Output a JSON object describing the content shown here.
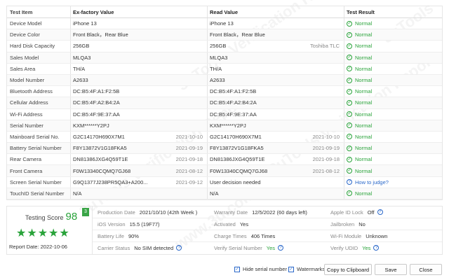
{
  "watermarks": [
    "3uTools Verification Report",
    "3uTools Verification Report",
    "3uTools Verification Report",
    "3uTools",
    "www.3u.com"
  ],
  "table": {
    "headers": [
      "Test Item",
      "Ex-factory Value",
      "Read Value",
      "Test Result"
    ],
    "rows": [
      {
        "item": "Device Model",
        "ex": "iPhone 13",
        "ex_date": "",
        "read": "iPhone 13",
        "read_extra": "",
        "result": "Normal",
        "status": "ok"
      },
      {
        "item": "Device Color",
        "ex": "Front Black，Rear Blue",
        "ex_date": "",
        "read": "Front Black，Rear Blue",
        "read_extra": "",
        "result": "Normal",
        "status": "ok"
      },
      {
        "item": "Hard Disk Capacity",
        "ex": "256GB",
        "ex_date": "",
        "read": "256GB",
        "read_extra": "Toshiba TLC",
        "result": "Normal",
        "status": "ok"
      },
      {
        "item": "Sales Model",
        "ex": "MLQA3",
        "ex_date": "",
        "read": "MLQA3",
        "read_extra": "",
        "result": "Normal",
        "status": "ok"
      },
      {
        "item": "Sales Area",
        "ex": "TH/A",
        "ex_date": "",
        "read": "TH/A",
        "read_extra": "",
        "result": "Normal",
        "status": "ok"
      },
      {
        "item": "Model Number",
        "ex": "A2633",
        "ex_date": "",
        "read": "A2633",
        "read_extra": "",
        "result": "Normal",
        "status": "ok"
      },
      {
        "item": "Bluetooth Address",
        "ex": "DC:B5:4F:A1:F2:5B",
        "ex_date": "",
        "read": "DC:B5:4F:A1:F2:5B",
        "read_extra": "",
        "result": "Normal",
        "status": "ok"
      },
      {
        "item": "Cellular Address",
        "ex": "DC:B5:4F:A2:B4:2A",
        "ex_date": "",
        "read": "DC:B5:4F:A2:B4:2A",
        "read_extra": "",
        "result": "Normal",
        "status": "ok"
      },
      {
        "item": "Wi-Fi Address",
        "ex": "DC:B5:4F:9E:37:AA",
        "ex_date": "",
        "read": "DC:B5:4F:9E:37:AA",
        "read_extra": "",
        "result": "Normal",
        "status": "ok"
      },
      {
        "item": "Serial Number",
        "ex": "KXM******Y2PJ",
        "ex_date": "",
        "read": "KXM******Y2PJ",
        "read_extra": "",
        "result": "Normal",
        "status": "ok"
      },
      {
        "item": "Mainboard Serial No.",
        "ex": "G2C14170H690X7M1",
        "ex_date": "2021-10-10",
        "read": "G2C14170H690X7M1",
        "read_extra": "2021-10-10",
        "result": "Normal",
        "status": "ok"
      },
      {
        "item": "Battery Serial Number",
        "ex": "F8Y13872V1G18FKA5",
        "ex_date": "2021-09-19",
        "read": "F8Y13872V1G18FKA5",
        "read_extra": "2021-09-19",
        "result": "Normal",
        "status": "ok"
      },
      {
        "item": "Rear Camera",
        "ex": "DN81386JXG4Q59T1E",
        "ex_date": "2021-09-18",
        "read": "DN81386JXG4Q59T1E",
        "read_extra": "2021-09-18",
        "result": "Normal",
        "status": "ok"
      },
      {
        "item": "Front Camera",
        "ex": "F0W13340CQMQ7GJ68",
        "ex_date": "2021-08-12",
        "read": "F0W13340CQMQ7GJ68",
        "read_extra": "2021-08-12",
        "result": "Normal",
        "status": "ok"
      },
      {
        "item": "Screen Serial Number",
        "ex": "G9Q1377J238PR5QA3+A200...",
        "ex_date": "2021-09-12",
        "read": "User decision needed",
        "read_extra": "",
        "result": "How to judge?",
        "status": "help"
      },
      {
        "item": "TouchID Serial Number",
        "ex": "N/A",
        "ex_date": "",
        "read": "N/A",
        "read_extra": "",
        "result": "Normal",
        "status": "ok"
      }
    ]
  },
  "score": {
    "label": "Testing Score",
    "value": "98",
    "badge": "3",
    "stars": "★★★★★",
    "report_date": "Report Date:  2022-10-06"
  },
  "info": {
    "production_date": {
      "key": "Production Date",
      "value": "2021/10/10 (42th Week )"
    },
    "ios_version": {
      "key": "iOS Version",
      "value": "15.5 (19F77)"
    },
    "battery_life": {
      "key": "Battery Life",
      "value": "90%"
    },
    "carrier_status": {
      "key": "Carrier Status",
      "value": "No SIM detected"
    },
    "warranty_date": {
      "key": "Warranty Date",
      "value": "12/5/2022 (60 days left)"
    },
    "activated": {
      "key": "Activated",
      "value": "Yes"
    },
    "charge_times": {
      "key": "Charge Times",
      "value": "406 Times"
    },
    "verify_serial": {
      "key": "Verify Serial Number",
      "value": "Yes"
    },
    "apple_id_lock": {
      "key": "Apple ID Lock",
      "value": "Off"
    },
    "jailbroken": {
      "key": "Jailbroken",
      "value": "No"
    },
    "wifi_module": {
      "key": "Wi-Fi Module",
      "value": "Unknown"
    },
    "verify_udid": {
      "key": "Verify UDID",
      "value": "Yes"
    }
  },
  "footer": {
    "hide_serial_label": "Hide serial number",
    "watermarks_label": "Watermarks",
    "copy_label": "Copy to Clipboard",
    "save_label": "Save",
    "close_label": "Close"
  },
  "colors": {
    "ok": "#29a33a",
    "help": "#2a68c9",
    "border": "#e6e6e6"
  }
}
